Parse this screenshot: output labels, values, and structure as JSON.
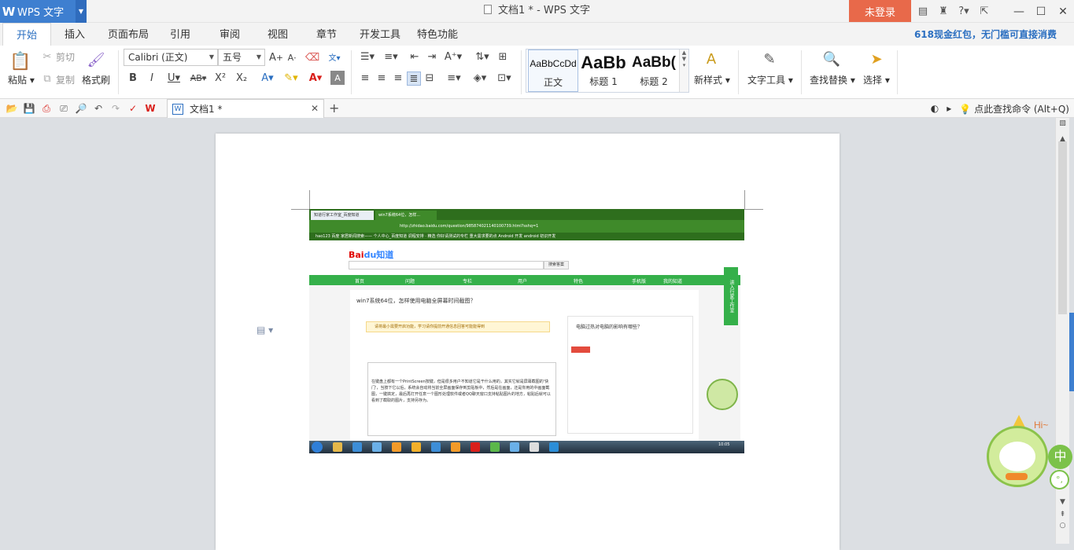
{
  "app": {
    "menu_label": "WPS 文字",
    "logo": "W",
    "window_title": "文档1 * - WPS 文字",
    "login_button": "未登录",
    "title_icons": [
      "skin-icon",
      "shirt-icon",
      "help-icon",
      "restore-ribbon-icon"
    ],
    "accent_color": "#3e7fd0",
    "login_color": "#e8694a"
  },
  "tabs": [
    "开始",
    "插入",
    "页面布局",
    "引用",
    "审阅",
    "视图",
    "章节",
    "开发工具",
    "特色功能"
  ],
  "promo": "618现金红包，无门槛可直接消费",
  "ribbon": {
    "paste": "粘贴",
    "cut": "剪切",
    "copy": "复制",
    "format_painter": "格式刷",
    "font_name": "Calibri (正文)",
    "font_size": "五号",
    "styles": [
      {
        "sample": "AaBbCcDd",
        "name": "正文"
      },
      {
        "sample": "AaBb",
        "name": "标题 1"
      },
      {
        "sample": "AaBb(",
        "name": "标题 2"
      }
    ],
    "new_style": "新样式",
    "text_tools": "文字工具",
    "find_replace": "查找替换",
    "select": "选择"
  },
  "quick_access": {
    "doc_tab_title": "文档1 *",
    "new_tab": "+",
    "search_command": "点此查找命令 (Alt+Q)"
  },
  "embedded_screenshot": {
    "tab1": "知道行家工作室_百度知道",
    "tab2": "win7系统64位，怎样...",
    "url": "http://zhidao.baidu.com/question/985874021140100739.html?sshq=1",
    "bookmarks": "hao123  百度  家居新闻搜索——  个人中心_百度知道  调程安排 · 精选  你好请测试的专栏  重大需求要的点  Android 开发  android 初识开发",
    "logo": "Bai",
    "logo_accent": "du知道",
    "search_button": "搜索答案",
    "nav": [
      "首页",
      "问题",
      "专栏",
      "用户",
      "特色",
      "手机版",
      "我的知道"
    ],
    "side_label": "进入行家工作室",
    "question": "win7系统64位，怎样使用电脑全屏幕时间截图？",
    "tip": "请将最小需要开启功能，学习请你提前开通信息回答可能能得到",
    "answer": "在键盘上都有一个PrintScreen按键，但是很多用户不知道它是干什么用的，其实它就是屏幕截图的'快门'，当按下它以后，系统会自动将当前全屏画面保存到剪贴板中，然后是在画面，还是你用的中画面截图，一键搞定，最后再打开任意一个图形处理软件或者QQ聊天窗口支持粘贴图片的地方，粘贴后就可以看到了截取的图片，支持另存为。",
    "right_title": "电脑过热对电脑的影响有哪些？",
    "clock": "10:05"
  },
  "mascot": {
    "greeting": "Hi~",
    "ime_label": "中",
    "ime_mode": "°,"
  }
}
